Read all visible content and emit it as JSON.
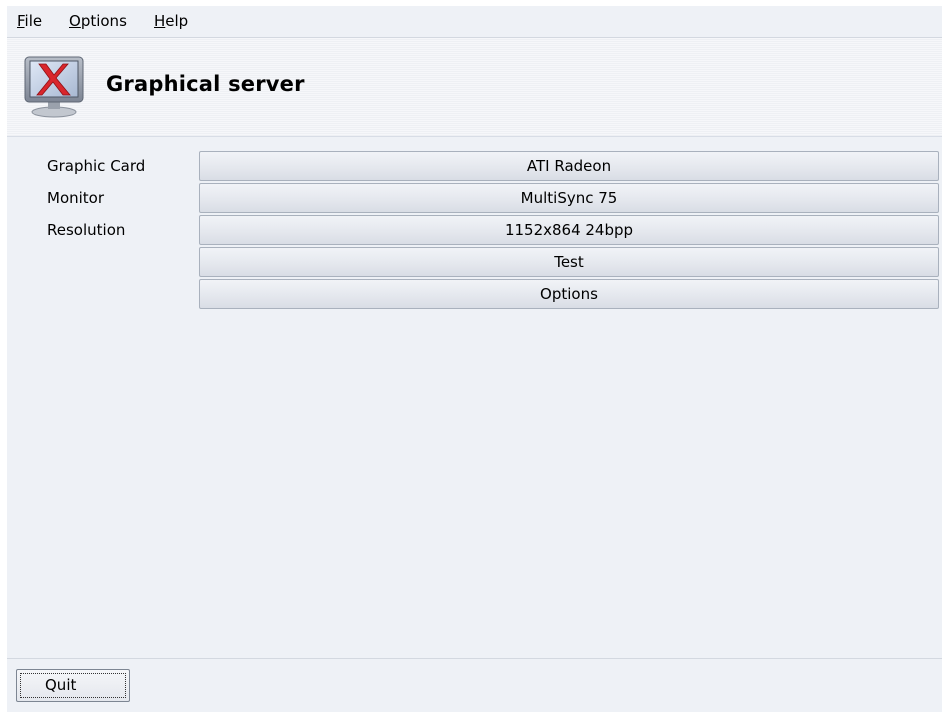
{
  "menu": {
    "file": {
      "mnemonic": "F",
      "rest": "ile"
    },
    "options": {
      "mnemonic": "O",
      "rest": "ptions"
    },
    "help": {
      "mnemonic": "H",
      "rest": "elp"
    }
  },
  "header": {
    "title": "Graphical server",
    "icon": "x-monitor-icon"
  },
  "settings": {
    "rows": [
      {
        "label": "Graphic Card",
        "value": "ATI Radeon"
      },
      {
        "label": "Monitor",
        "value": "MultiSync 75"
      },
      {
        "label": "Resolution",
        "value": "1152x864 24bpp"
      }
    ],
    "test_label": "Test",
    "options_label": "Options"
  },
  "footer": {
    "quit_label": "Quit"
  },
  "colors": {
    "window_bg": "#eef1f6",
    "icon_x": "#d9262c"
  }
}
